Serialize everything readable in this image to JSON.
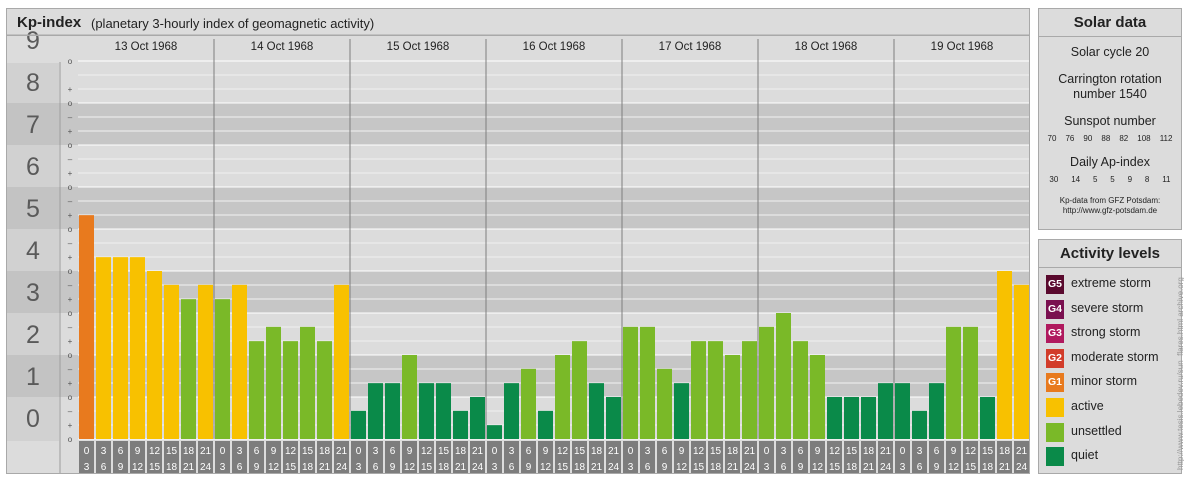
{
  "header": {
    "title": "Kp-index",
    "subtitle": "(planetary 3-hourly index of geomagnetic activity)"
  },
  "chart_data": {
    "type": "bar",
    "kp_scale": [
      "0",
      "1",
      "2",
      "3",
      "4",
      "5",
      "6",
      "7",
      "8",
      "9"
    ],
    "ylim": [
      0,
      9
    ],
    "subdivision_marks": [
      "+",
      "o",
      "–"
    ],
    "days": [
      {
        "date": "13 Oct 1968",
        "values": [
          5.33,
          4.33,
          4.33,
          4.33,
          4.0,
          3.67,
          3.33,
          3.67
        ]
      },
      {
        "date": "14 Oct 1968",
        "values": [
          3.33,
          3.67,
          2.33,
          2.67,
          2.33,
          2.67,
          2.33,
          3.67
        ]
      },
      {
        "date": "15 Oct 1968",
        "values": [
          0.67,
          1.33,
          1.33,
          2.0,
          1.33,
          1.33,
          0.67,
          1.0
        ]
      },
      {
        "date": "16 Oct 1968",
        "values": [
          0.33,
          1.33,
          1.67,
          0.67,
          2.0,
          2.33,
          1.33,
          1.0
        ]
      },
      {
        "date": "17 Oct 1968",
        "values": [
          2.67,
          2.67,
          1.67,
          1.33,
          2.33,
          2.33,
          2.0,
          2.33
        ]
      },
      {
        "date": "18 Oct 1968",
        "values": [
          2.67,
          3.0,
          2.33,
          2.0,
          1.0,
          1.0,
          1.0,
          1.33
        ]
      },
      {
        "date": "19 Oct 1968",
        "values": [
          1.33,
          0.67,
          1.33,
          2.67,
          2.67,
          1.0,
          4.0,
          3.67
        ]
      }
    ],
    "hour_ranges_top": [
      "0",
      "3",
      "6",
      "9",
      "12",
      "15",
      "18",
      "21"
    ],
    "hour_ranges_bottom": [
      "3",
      "6",
      "9",
      "12",
      "15",
      "18",
      "21",
      "24"
    ],
    "colors": {
      "quiet": "#0a8a49",
      "unsettled": "#7ab928",
      "active": "#f8c100",
      "minor_storm": "#e87a1e"
    }
  },
  "solar": {
    "title": "Solar data",
    "cycle": "Solar cycle 20",
    "carrington_line1": "Carrington rotation",
    "carrington_line2": "number 1540",
    "sunspot_label": "Sunspot number",
    "sunspot_values": [
      "70",
      "76",
      "90",
      "88",
      "82",
      "108",
      "112"
    ],
    "ap_label": "Daily Ap-index",
    "ap_values": [
      "30",
      "14",
      "5",
      "5",
      "9",
      "8",
      "11"
    ],
    "credit_line1": "Kp-data from GFZ Potsdam:",
    "credit_line2": "http://www.gfz-potsdam.de"
  },
  "levels": {
    "title": "Activity levels",
    "items": [
      {
        "code": "G5",
        "label": "extreme storm",
        "color": "#5a0a2e"
      },
      {
        "code": "G4",
        "label": "severe storm",
        "color": "#7a1050"
      },
      {
        "code": "G3",
        "label": "strong storm",
        "color": "#b0195e"
      },
      {
        "code": "G2",
        "label": "moderate storm",
        "color": "#d23c2a"
      },
      {
        "code": "G1",
        "label": "minor storm",
        "color": "#e87a1e"
      },
      {
        "code": "",
        "label": "active",
        "color": "#f8c100"
      },
      {
        "code": "",
        "label": "unsettled",
        "color": "#7ab928"
      },
      {
        "code": "",
        "label": "quiet",
        "color": "#0a8a49"
      }
    ]
  },
  "watermark": "http://www.tesis.lebedev.ru/sun_flares.html archive.org"
}
